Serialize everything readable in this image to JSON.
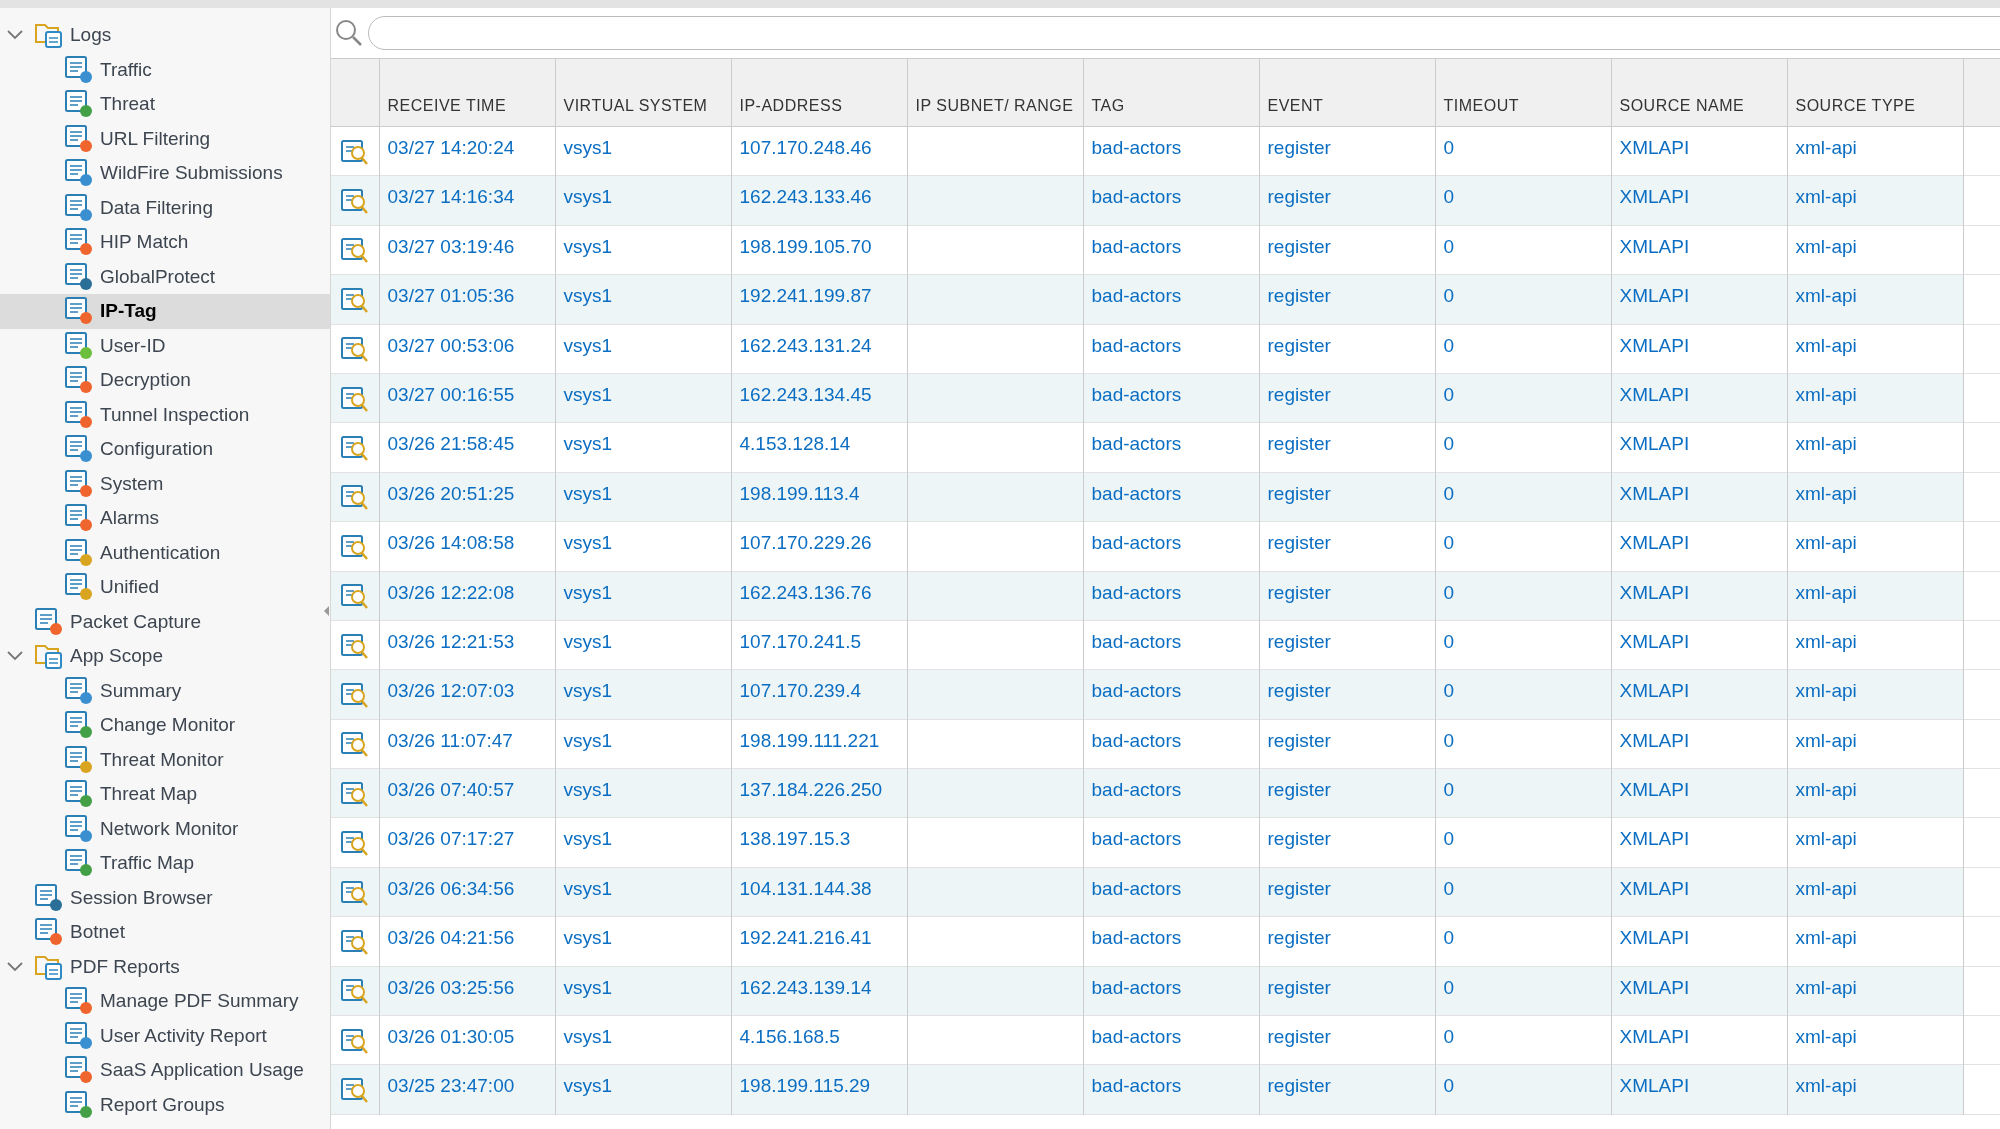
{
  "sidebar": {
    "items": [
      {
        "label": "Logs",
        "expanded": true,
        "selected": false,
        "children": [
          {
            "label": "Traffic",
            "selected": false
          },
          {
            "label": "Threat",
            "selected": false
          },
          {
            "label": "URL Filtering",
            "selected": false
          },
          {
            "label": "WildFire Submissions",
            "selected": false
          },
          {
            "label": "Data Filtering",
            "selected": false
          },
          {
            "label": "HIP Match",
            "selected": false
          },
          {
            "label": "GlobalProtect",
            "selected": false
          },
          {
            "label": "IP-Tag",
            "selected": true
          },
          {
            "label": "User-ID",
            "selected": false
          },
          {
            "label": "Decryption",
            "selected": false
          },
          {
            "label": "Tunnel Inspection",
            "selected": false
          },
          {
            "label": "Configuration",
            "selected": false
          },
          {
            "label": "System",
            "selected": false
          },
          {
            "label": "Alarms",
            "selected": false
          },
          {
            "label": "Authentication",
            "selected": false
          },
          {
            "label": "Unified",
            "selected": false
          }
        ]
      },
      {
        "label": "Packet Capture",
        "selected": false
      },
      {
        "label": "App Scope",
        "expanded": true,
        "selected": false,
        "children": [
          {
            "label": "Summary",
            "selected": false
          },
          {
            "label": "Change Monitor",
            "selected": false
          },
          {
            "label": "Threat Monitor",
            "selected": false
          },
          {
            "label": "Threat Map",
            "selected": false
          },
          {
            "label": "Network Monitor",
            "selected": false
          },
          {
            "label": "Traffic Map",
            "selected": false
          }
        ]
      },
      {
        "label": "Session Browser",
        "selected": false
      },
      {
        "label": "Botnet",
        "selected": false
      },
      {
        "label": "PDF Reports",
        "expanded": true,
        "selected": false,
        "children": [
          {
            "label": "Manage PDF Summary",
            "selected": false
          },
          {
            "label": "User Activity Report",
            "selected": false
          },
          {
            "label": "SaaS Application Usage",
            "selected": false
          },
          {
            "label": "Report Groups",
            "selected": false
          }
        ]
      }
    ]
  },
  "table": {
    "columns": [
      "RECEIVE TIME",
      "VIRTUAL SYSTEM",
      "IP-ADDRESS",
      "IP SUBNET/ RANGE",
      "TAG",
      "EVENT",
      "TIMEOUT",
      "SOURCE NAME",
      "SOURCE TYPE"
    ],
    "rows": [
      {
        "receive_time": "03/27 14:20:24",
        "virtual_system": "vsys1",
        "ip_address": "107.170.248.46",
        "tag": "bad-actors",
        "event": "register",
        "timeout": "0",
        "source_name": "XMLAPI",
        "source_type": "xml-api"
      },
      {
        "receive_time": "03/27 14:16:34",
        "virtual_system": "vsys1",
        "ip_address": "162.243.133.46",
        "tag": "bad-actors",
        "event": "register",
        "timeout": "0",
        "source_name": "XMLAPI",
        "source_type": "xml-api"
      },
      {
        "receive_time": "03/27 03:19:46",
        "virtual_system": "vsys1",
        "ip_address": "198.199.105.70",
        "tag": "bad-actors",
        "event": "register",
        "timeout": "0",
        "source_name": "XMLAPI",
        "source_type": "xml-api"
      },
      {
        "receive_time": "03/27 01:05:36",
        "virtual_system": "vsys1",
        "ip_address": "192.241.199.87",
        "tag": "bad-actors",
        "event": "register",
        "timeout": "0",
        "source_name": "XMLAPI",
        "source_type": "xml-api"
      },
      {
        "receive_time": "03/27 00:53:06",
        "virtual_system": "vsys1",
        "ip_address": "162.243.131.24",
        "tag": "bad-actors",
        "event": "register",
        "timeout": "0",
        "source_name": "XMLAPI",
        "source_type": "xml-api"
      },
      {
        "receive_time": "03/27 00:16:55",
        "virtual_system": "vsys1",
        "ip_address": "162.243.134.45",
        "tag": "bad-actors",
        "event": "register",
        "timeout": "0",
        "source_name": "XMLAPI",
        "source_type": "xml-api"
      },
      {
        "receive_time": "03/26 21:58:45",
        "virtual_system": "vsys1",
        "ip_address": "4.153.128.14",
        "tag": "bad-actors",
        "event": "register",
        "timeout": "0",
        "source_name": "XMLAPI",
        "source_type": "xml-api"
      },
      {
        "receive_time": "03/26 20:51:25",
        "virtual_system": "vsys1",
        "ip_address": "198.199.113.4",
        "tag": "bad-actors",
        "event": "register",
        "timeout": "0",
        "source_name": "XMLAPI",
        "source_type": "xml-api"
      },
      {
        "receive_time": "03/26 14:08:58",
        "virtual_system": "vsys1",
        "ip_address": "107.170.229.26",
        "tag": "bad-actors",
        "event": "register",
        "timeout": "0",
        "source_name": "XMLAPI",
        "source_type": "xml-api"
      },
      {
        "receive_time": "03/26 12:22:08",
        "virtual_system": "vsys1",
        "ip_address": "162.243.136.76",
        "tag": "bad-actors",
        "event": "register",
        "timeout": "0",
        "source_name": "XMLAPI",
        "source_type": "xml-api"
      },
      {
        "receive_time": "03/26 12:21:53",
        "virtual_system": "vsys1",
        "ip_address": "107.170.241.5",
        "tag": "bad-actors",
        "event": "register",
        "timeout": "0",
        "source_name": "XMLAPI",
        "source_type": "xml-api"
      },
      {
        "receive_time": "03/26 12:07:03",
        "virtual_system": "vsys1",
        "ip_address": "107.170.239.4",
        "tag": "bad-actors",
        "event": "register",
        "timeout": "0",
        "source_name": "XMLAPI",
        "source_type": "xml-api"
      },
      {
        "receive_time": "03/26 11:07:47",
        "virtual_system": "vsys1",
        "ip_address": "198.199.111.221",
        "tag": "bad-actors",
        "event": "register",
        "timeout": "0",
        "source_name": "XMLAPI",
        "source_type": "xml-api"
      },
      {
        "receive_time": "03/26 07:40:57",
        "virtual_system": "vsys1",
        "ip_address": "137.184.226.250",
        "tag": "bad-actors",
        "event": "register",
        "timeout": "0",
        "source_name": "XMLAPI",
        "source_type": "xml-api"
      },
      {
        "receive_time": "03/26 07:17:27",
        "virtual_system": "vsys1",
        "ip_address": "138.197.15.3",
        "tag": "bad-actors",
        "event": "register",
        "timeout": "0",
        "source_name": "XMLAPI",
        "source_type": "xml-api"
      },
      {
        "receive_time": "03/26 06:34:56",
        "virtual_system": "vsys1",
        "ip_address": "104.131.144.38",
        "tag": "bad-actors",
        "event": "register",
        "timeout": "0",
        "source_name": "XMLAPI",
        "source_type": "xml-api"
      },
      {
        "receive_time": "03/26 04:21:56",
        "virtual_system": "vsys1",
        "ip_address": "192.241.216.41",
        "tag": "bad-actors",
        "event": "register",
        "timeout": "0",
        "source_name": "XMLAPI",
        "source_type": "xml-api"
      },
      {
        "receive_time": "03/26 03:25:56",
        "virtual_system": "vsys1",
        "ip_address": "162.243.139.14",
        "tag": "bad-actors",
        "event": "register",
        "timeout": "0",
        "source_name": "XMLAPI",
        "source_type": "xml-api"
      },
      {
        "receive_time": "03/26 01:30:05",
        "virtual_system": "vsys1",
        "ip_address": "4.156.168.5",
        "tag": "bad-actors",
        "event": "register",
        "timeout": "0",
        "source_name": "XMLAPI",
        "source_type": "xml-api"
      },
      {
        "receive_time": "03/25 23:47:00",
        "virtual_system": "vsys1",
        "ip_address": "198.199.115.29",
        "tag": "bad-actors",
        "event": "register",
        "timeout": "0",
        "source_name": "XMLAPI",
        "source_type": "xml-api"
      }
    ]
  }
}
